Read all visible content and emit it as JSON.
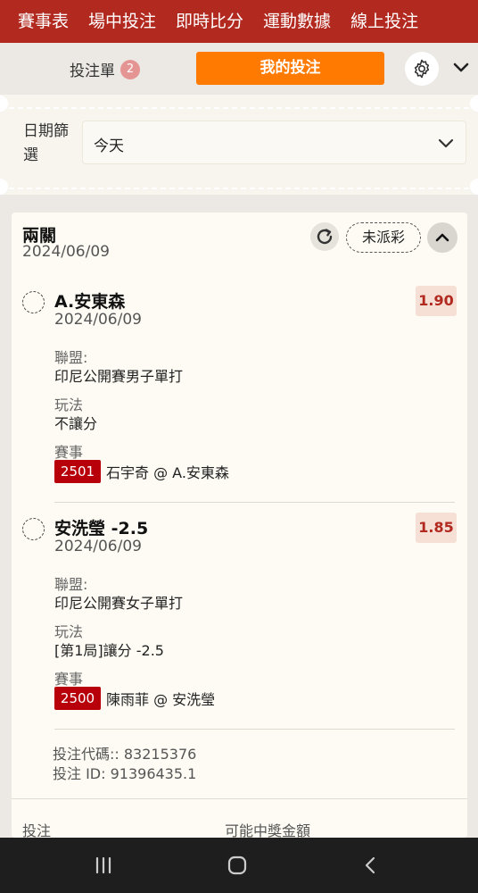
{
  "topnav": {
    "items": [
      "賽事表",
      "場中投注",
      "即時比分",
      "運動數據",
      "線上投注"
    ]
  },
  "slipbar": {
    "slip_label": "投注單",
    "slip_count": "2",
    "mybets_label": "我的投注"
  },
  "filter": {
    "label": "日期篩選",
    "value": "今天"
  },
  "bet": {
    "type": "兩關",
    "date": "2024/06/09",
    "status": "未派彩",
    "legs": [
      {
        "selection": "A.安東森",
        "date": "2024/06/09",
        "odds": "1.90",
        "league_label": "聯盟:",
        "league": "印尼公開賽男子單打",
        "market_label": "玩法",
        "market": "不讓分",
        "event_label": "賽事",
        "event_code": "2501",
        "event": "石宇奇 @ A.安東森"
      },
      {
        "selection": "安洗瑩 -2.5",
        "date": "2024/06/09",
        "odds": "1.85",
        "league_label": "聯盟:",
        "league": "印尼公開賽女子單打",
        "market_label": "玩法",
        "market": "[第1局]讓分 -2.5",
        "event_label": "賽事",
        "event_code": "2500",
        "event": "陳雨菲 @ 安洗瑩"
      }
    ],
    "bet_code": "投注代碼:: 83215376",
    "bet_id": "投注 ID: 91396435.1",
    "stake_label": "投注",
    "payout_label": "可能中獎金額"
  },
  "colors": {
    "brand_red": "#b2291f",
    "orange": "#ff7a00",
    "event_red": "#b8000a"
  },
  "icons": [
    "gear-icon",
    "chevron-down-icon",
    "refresh-icon",
    "chevron-up-icon",
    "recent-apps-icon",
    "home-icon",
    "back-icon"
  ]
}
